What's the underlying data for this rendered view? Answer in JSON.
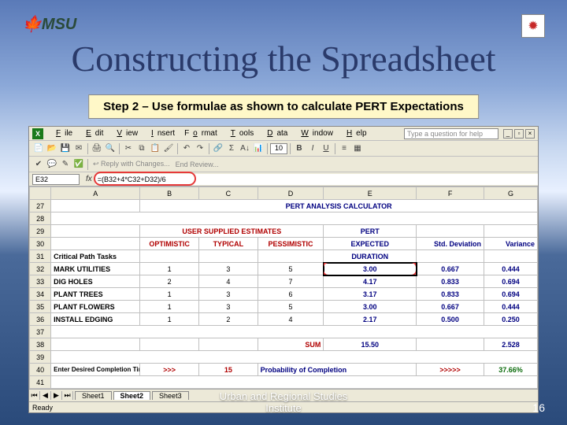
{
  "slide": {
    "logo_left": "MSU",
    "title": "Constructing the Spreadsheet",
    "subtitle": "Step 2 – Use formulae as shown to calculate PERT Expectations",
    "footer": "Urban and Regional Studies\nInstitute",
    "page": "16"
  },
  "menu": {
    "items": [
      "File",
      "Edit",
      "View",
      "Insert",
      "Format",
      "Tools",
      "Data",
      "Window",
      "Help"
    ],
    "help_placeholder": "Type a question for help"
  },
  "toolbar2": {
    "reply": "Reply with Changes...",
    "end_review": "End Review...",
    "font_size": "10"
  },
  "formula": {
    "cell_ref": "E32",
    "formula": "=(B32+4*C32+D32)/6"
  },
  "sheet": {
    "cols": [
      "A",
      "B",
      "C",
      "D",
      "E",
      "F",
      "G"
    ],
    "rows_start": 27,
    "title": "PERT ANALYSIS CALCULATOR",
    "user_header": "USER SUPPLIED ESTIMATES",
    "col_labels": {
      "opt": "OPTIMISTIC",
      "typ": "TYPICAL",
      "pes": "PESSIMISTIC",
      "pert1": "PERT",
      "pert2": "EXPECTED",
      "pert3": "DURATION",
      "std": "Std. Deviation",
      "var": "Variance"
    },
    "task_header": "Critical Path Tasks",
    "tasks": [
      {
        "n": "32",
        "name": "MARK UTILITIES",
        "o": "1",
        "t": "3",
        "p": "5",
        "e": "3.00",
        "s": "0.667",
        "v": "0.444"
      },
      {
        "n": "33",
        "name": "DIG HOLES",
        "o": "2",
        "t": "4",
        "p": "7",
        "e": "4.17",
        "s": "0.833",
        "v": "0.694"
      },
      {
        "n": "34",
        "name": "PLANT TREES",
        "o": "1",
        "t": "3",
        "p": "6",
        "e": "3.17",
        "s": "0.833",
        "v": "0.694"
      },
      {
        "n": "35",
        "name": "PLANT FLOWERS",
        "o": "1",
        "t": "3",
        "p": "5",
        "e": "3.00",
        "s": "0.667",
        "v": "0.444"
      },
      {
        "n": "36",
        "name": "INSTALL EDGING",
        "o": "1",
        "t": "2",
        "p": "4",
        "e": "2.17",
        "s": "0.500",
        "v": "0.250"
      }
    ],
    "sum_label": "SUM",
    "sum_e": "15.50",
    "sum_v": "2.528",
    "completion_label": "Enter Desired Completion Time",
    "arrows": ">>>",
    "completion_val": "15",
    "prob_label": "Probability of Completion",
    "prob_arrows": ">>>>>",
    "prob_val": "37.66%"
  },
  "tabs": {
    "items": [
      "Sheet1",
      "Sheet2",
      "Sheet3"
    ],
    "active": 1
  },
  "status": "Ready"
}
